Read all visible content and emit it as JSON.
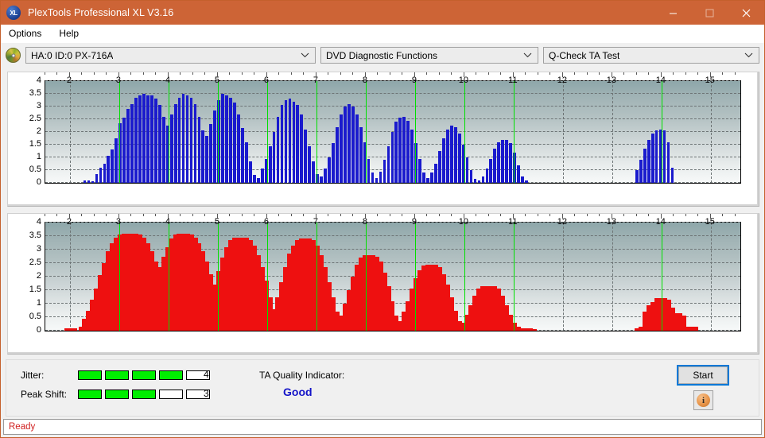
{
  "window": {
    "title": "PlexTools Professional XL V3.16",
    "app_icon": "xl-logo-icon",
    "minimize_label": "minimize-icon",
    "maximize_label": "maximize-icon",
    "close_label": "close-icon"
  },
  "menu": {
    "items": [
      {
        "label": "Options"
      },
      {
        "label": "Help"
      }
    ]
  },
  "toolbar": {
    "device_icon": "optical-disc-icon",
    "device": "HA:0 ID:0  PX-716A",
    "function": "DVD Diagnostic Functions",
    "test": "Q-Check TA Test"
  },
  "status_panel": {
    "jitter_label": "Jitter:",
    "jitter_value": "4",
    "jitter_filled": 4,
    "jitter_total": 5,
    "peak_shift_label": "Peak Shift:",
    "peak_shift_value": "3",
    "peak_shift_filled": 3,
    "peak_shift_total": 5,
    "tqi_label": "TA Quality Indicator:",
    "tqi_value": "Good",
    "tqi_color": "#1414c8",
    "meter_on_color": "#00ee00",
    "start_label": "Start",
    "info_label": "i"
  },
  "statusbar": {
    "text": "Ready",
    "color": "#d02020"
  },
  "chart_data": [
    {
      "type": "bar",
      "name": "jitter-chart",
      "title": "",
      "xlabel": "",
      "ylabel": "",
      "series_color": "#1a1acd",
      "grid": true,
      "legend": "none",
      "ylim": [
        0,
        4
      ],
      "yticks": [
        0,
        0.5,
        1,
        1.5,
        2,
        2.5,
        3,
        3.5,
        4
      ],
      "ytick_labels": [
        "0",
        "0.5",
        "1",
        "1.5",
        "2",
        "2.5",
        "3",
        "3.5",
        "4"
      ],
      "xlim": [
        1.5,
        15.6
      ],
      "xticks": [
        2,
        3,
        4,
        5,
        6,
        7,
        8,
        9,
        10,
        11,
        12,
        13,
        14,
        15
      ],
      "xtick_labels": [
        "2",
        "3",
        "4",
        "5",
        "6",
        "7",
        "8",
        "9",
        "10",
        "11",
        "12",
        "13",
        "14",
        "15"
      ],
      "markers": [
        3,
        4,
        5,
        6,
        7,
        8,
        9,
        10,
        11,
        14
      ],
      "marker_color": "#00e000",
      "x": [
        2.3,
        2.38,
        2.46,
        2.54,
        2.62,
        2.7,
        2.78,
        2.86,
        2.94,
        3.02,
        3.1,
        3.18,
        3.26,
        3.34,
        3.42,
        3.5,
        3.58,
        3.66,
        3.74,
        3.82,
        3.9,
        3.98,
        4.06,
        4.14,
        4.22,
        4.3,
        4.38,
        4.46,
        4.54,
        4.62,
        4.7,
        4.78,
        4.86,
        4.94,
        5.02,
        5.1,
        5.18,
        5.26,
        5.34,
        5.42,
        5.5,
        5.58,
        5.66,
        5.74,
        5.82,
        5.9,
        5.98,
        6.06,
        6.14,
        6.22,
        6.3,
        6.38,
        6.46,
        6.54,
        6.62,
        6.7,
        6.78,
        6.86,
        6.94,
        7.02,
        7.1,
        7.18,
        7.26,
        7.34,
        7.42,
        7.5,
        7.58,
        7.66,
        7.74,
        7.82,
        7.9,
        7.98,
        8.06,
        8.14,
        8.22,
        8.3,
        8.38,
        8.46,
        8.54,
        8.62,
        8.7,
        8.78,
        8.86,
        8.94,
        9.02,
        9.1,
        9.18,
        9.26,
        9.34,
        9.42,
        9.5,
        9.58,
        9.66,
        9.74,
        9.82,
        9.9,
        9.98,
        10.06,
        10.14,
        10.22,
        10.3,
        10.38,
        10.46,
        10.54,
        10.62,
        10.7,
        10.78,
        10.86,
        10.94,
        11.02,
        11.1,
        11.18,
        11.26,
        13.5,
        13.58,
        13.66,
        13.74,
        13.82,
        13.9,
        13.98,
        14.06,
        14.14,
        14.22
      ],
      "values": [
        0.1,
        0.1,
        0.05,
        0.35,
        0.6,
        0.75,
        1.05,
        1.3,
        1.75,
        2.35,
        2.55,
        2.9,
        3.1,
        3.35,
        3.45,
        3.5,
        3.45,
        3.45,
        3.3,
        3.05,
        2.6,
        2.25,
        2.7,
        3.1,
        3.35,
        3.5,
        3.45,
        3.35,
        3.1,
        2.6,
        2.05,
        1.85,
        2.3,
        2.85,
        3.25,
        3.5,
        3.45,
        3.35,
        3.15,
        2.7,
        2.15,
        1.6,
        0.85,
        0.3,
        0.2,
        0.55,
        0.95,
        1.45,
        2.0,
        2.6,
        3.05,
        3.25,
        3.3,
        3.2,
        3.05,
        2.7,
        2.1,
        1.45,
        0.85,
        0.35,
        0.25,
        0.55,
        1.0,
        1.55,
        2.2,
        2.7,
        3.0,
        3.1,
        3.0,
        2.7,
        2.2,
        1.6,
        0.95,
        0.4,
        0.2,
        0.45,
        0.9,
        1.45,
        2.0,
        2.4,
        2.55,
        2.6,
        2.45,
        2.1,
        1.55,
        0.95,
        0.4,
        0.2,
        0.4,
        0.75,
        1.25,
        1.75,
        2.1,
        2.25,
        2.2,
        1.95,
        1.5,
        1.0,
        0.5,
        0.15,
        0.1,
        0.25,
        0.55,
        0.95,
        1.35,
        1.6,
        1.7,
        1.7,
        1.55,
        1.2,
        0.7,
        0.25,
        0.1,
        0.5,
        0.9,
        1.35,
        1.7,
        1.95,
        2.05,
        2.1,
        2.05,
        1.6,
        0.6
      ]
    },
    {
      "type": "bar",
      "name": "peak-shift-chart",
      "title": "",
      "xlabel": "",
      "ylabel": "",
      "series_color": "#ee1010",
      "grid": true,
      "legend": "none",
      "ylim": [
        0,
        4
      ],
      "yticks": [
        0,
        0.5,
        1,
        1.5,
        2,
        2.5,
        3,
        3.5,
        4
      ],
      "ytick_labels": [
        "0",
        "0.5",
        "1",
        "1.5",
        "2",
        "2.5",
        "3",
        "3.5",
        "4"
      ],
      "xlim": [
        1.5,
        15.6
      ],
      "xticks": [
        2,
        3,
        4,
        5,
        6,
        7,
        8,
        9,
        10,
        11,
        12,
        13,
        14,
        15
      ],
      "xtick_labels": [
        "2",
        "3",
        "4",
        "5",
        "6",
        "7",
        "8",
        "9",
        "10",
        "11",
        "12",
        "13",
        "14",
        "15"
      ],
      "markers": [
        3,
        4,
        5,
        6,
        7,
        8,
        9,
        10,
        11,
        14
      ],
      "marker_color": "#00e000",
      "x": [
        2.02,
        2.3,
        2.38,
        2.46,
        2.54,
        2.62,
        2.7,
        2.78,
        2.86,
        2.94,
        3.02,
        3.1,
        3.18,
        3.26,
        3.34,
        3.42,
        3.5,
        3.58,
        3.66,
        3.74,
        3.82,
        3.9,
        3.98,
        4.06,
        4.14,
        4.22,
        4.3,
        4.38,
        4.46,
        4.54,
        4.62,
        4.7,
        4.78,
        4.86,
        4.94,
        5.02,
        5.1,
        5.18,
        5.26,
        5.34,
        5.42,
        5.5,
        5.58,
        5.66,
        5.74,
        5.82,
        5.9,
        5.98,
        6.06,
        6.14,
        6.22,
        6.3,
        6.38,
        6.46,
        6.54,
        6.62,
        6.7,
        6.78,
        6.86,
        6.94,
        7.02,
        7.1,
        7.18,
        7.26,
        7.34,
        7.42,
        7.5,
        7.58,
        7.66,
        7.74,
        7.82,
        7.9,
        7.98,
        8.06,
        8.14,
        8.22,
        8.3,
        8.38,
        8.46,
        8.54,
        8.62,
        8.7,
        8.78,
        8.86,
        8.94,
        9.02,
        9.1,
        9.18,
        9.26,
        9.34,
        9.42,
        9.5,
        9.58,
        9.66,
        9.74,
        9.82,
        9.9,
        9.98,
        10.06,
        10.14,
        10.22,
        10.3,
        10.38,
        10.46,
        10.54,
        10.62,
        10.7,
        10.78,
        10.86,
        10.94,
        11.02,
        11.1,
        11.18,
        11.26,
        11.34,
        13.58,
        13.66,
        13.74,
        13.82,
        13.9,
        13.98,
        14.06,
        14.14,
        14.22,
        14.3,
        14.38,
        14.54,
        14.62
      ],
      "values": [
        0.1,
        0.15,
        0.45,
        0.75,
        1.15,
        1.55,
        2.05,
        2.5,
        2.95,
        3.25,
        3.45,
        3.55,
        3.6,
        3.6,
        3.55,
        3.45,
        3.25,
        2.95,
        2.55,
        2.2,
        2.0,
        2.35,
        2.75,
        3.1,
        3.4,
        3.55,
        3.6,
        3.55,
        3.45,
        3.25,
        2.95,
        2.55,
        2.1,
        1.65,
        1.35,
        1.7,
        2.2,
        2.7,
        3.1,
        3.35,
        3.45,
        3.45,
        3.35,
        3.15,
        2.8,
        2.35,
        1.85,
        1.25,
        0.75,
        0.55,
        0.8,
        1.25,
        1.8,
        2.35,
        2.85,
        3.15,
        3.35,
        3.4,
        3.35,
        3.15,
        2.8,
        2.35,
        1.8,
        1.25,
        0.7,
        0.35,
        0.3,
        0.55,
        1.0,
        1.5,
        2.0,
        2.45,
        2.7,
        2.8,
        2.75,
        2.55,
        2.15,
        1.65,
        1.1,
        0.55,
        0.25,
        0.2,
        0.35,
        0.7,
        1.1,
        1.55,
        1.95,
        2.25,
        2.4,
        2.45,
        2.35,
        2.1,
        1.7,
        1.25,
        0.75,
        0.35,
        0.15,
        0.15,
        0.3,
        0.6,
        0.95,
        1.3,
        1.55,
        1.65,
        1.65,
        1.55,
        1.3,
        0.95,
        0.6,
        0.3,
        0.15,
        0.1,
        0.1,
        0.1,
        0.05,
        0.1,
        0.15,
        0.7,
        0.95,
        1.05,
        1.2,
        1.15,
        0.85,
        0.45,
        0.65,
        0.55,
        0.15,
        0.15
      ]
    }
  ]
}
